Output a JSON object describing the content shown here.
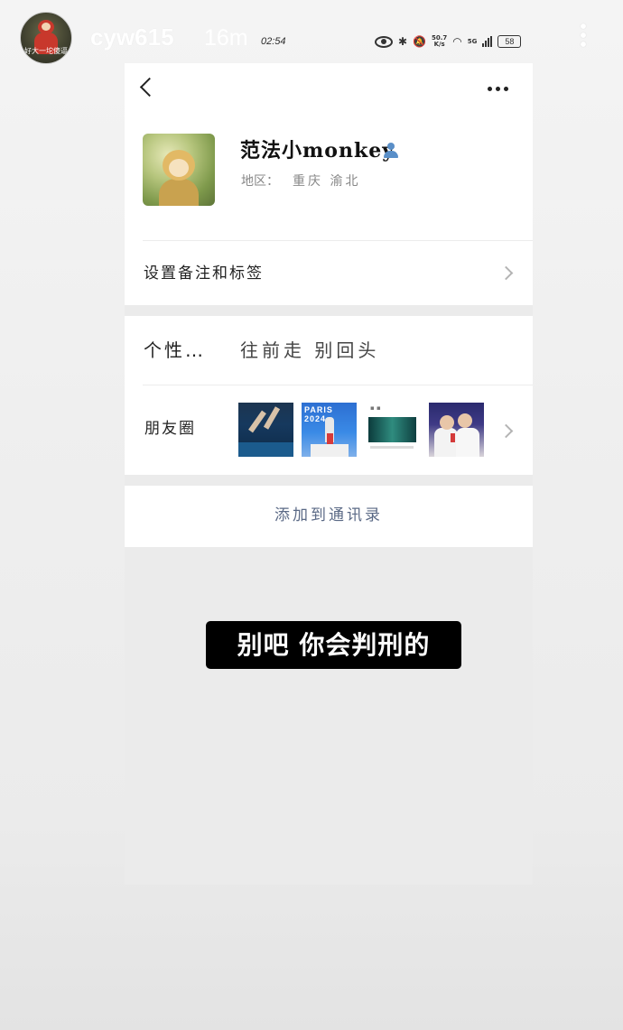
{
  "story": {
    "avatar_caption": "好大一坨傻逼",
    "username": "cyw615",
    "age": "16m",
    "subtitle": "别吧 你会判刑的"
  },
  "status_bar": {
    "time": "02:54",
    "net_speed_top": "50.7",
    "net_speed_bottom": "K/s",
    "network": "5G",
    "battery": "58"
  },
  "profile": {
    "name": "范法小monkey",
    "region_label": "地区：",
    "region_value": "重庆 渝北",
    "remarks_label": "设置备注和标签"
  },
  "signature": {
    "label": "个性…",
    "value": "往前走 别回头"
  },
  "moments": {
    "label": "朋友圈",
    "thumb2_text": "PARIS 2024"
  },
  "actions": {
    "add_contact": "添加到通讯录"
  },
  "icons": {
    "back": "chevron-left-icon",
    "more": "more-dots-icon",
    "verified": "person-icon",
    "row_arrow": "chevron-right-icon"
  },
  "colors": {
    "link_text": "#5b6a86",
    "verified_icon": "#5a8fc8",
    "subtitle_bg": "#000000"
  }
}
